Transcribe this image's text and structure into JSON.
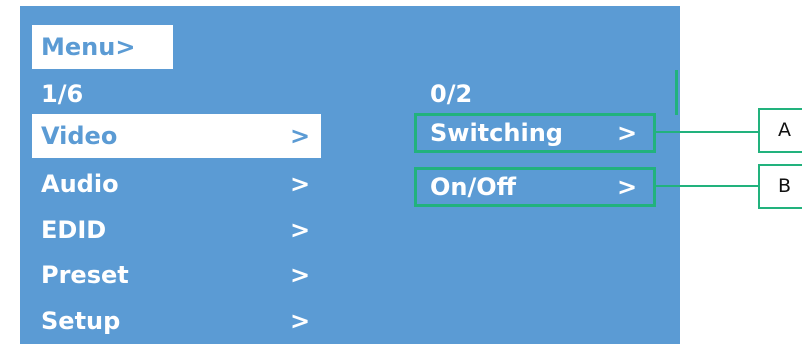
{
  "menu": {
    "title": "Menu>",
    "page_counter": "1/6",
    "items": [
      {
        "label": "Video",
        "arrow": ">"
      },
      {
        "label": "Audio",
        "arrow": ">"
      },
      {
        "label": "EDID",
        "arrow": ">"
      },
      {
        "label": "Preset",
        "arrow": ">"
      },
      {
        "label": "Setup",
        "arrow": ">"
      }
    ],
    "selected_index": 0
  },
  "submenu": {
    "page_counter": "0/2",
    "items": [
      {
        "label": "Switching",
        "arrow": ">"
      },
      {
        "label": "On/Off",
        "arrow": ">"
      }
    ]
  },
  "callouts": [
    {
      "label": "A"
    },
    {
      "label": "B"
    }
  ],
  "colors": {
    "screen_background": "#5b9bd4",
    "highlight_box": "#22b27d",
    "selected_background": "#ffffff",
    "text": "#ffffff"
  }
}
